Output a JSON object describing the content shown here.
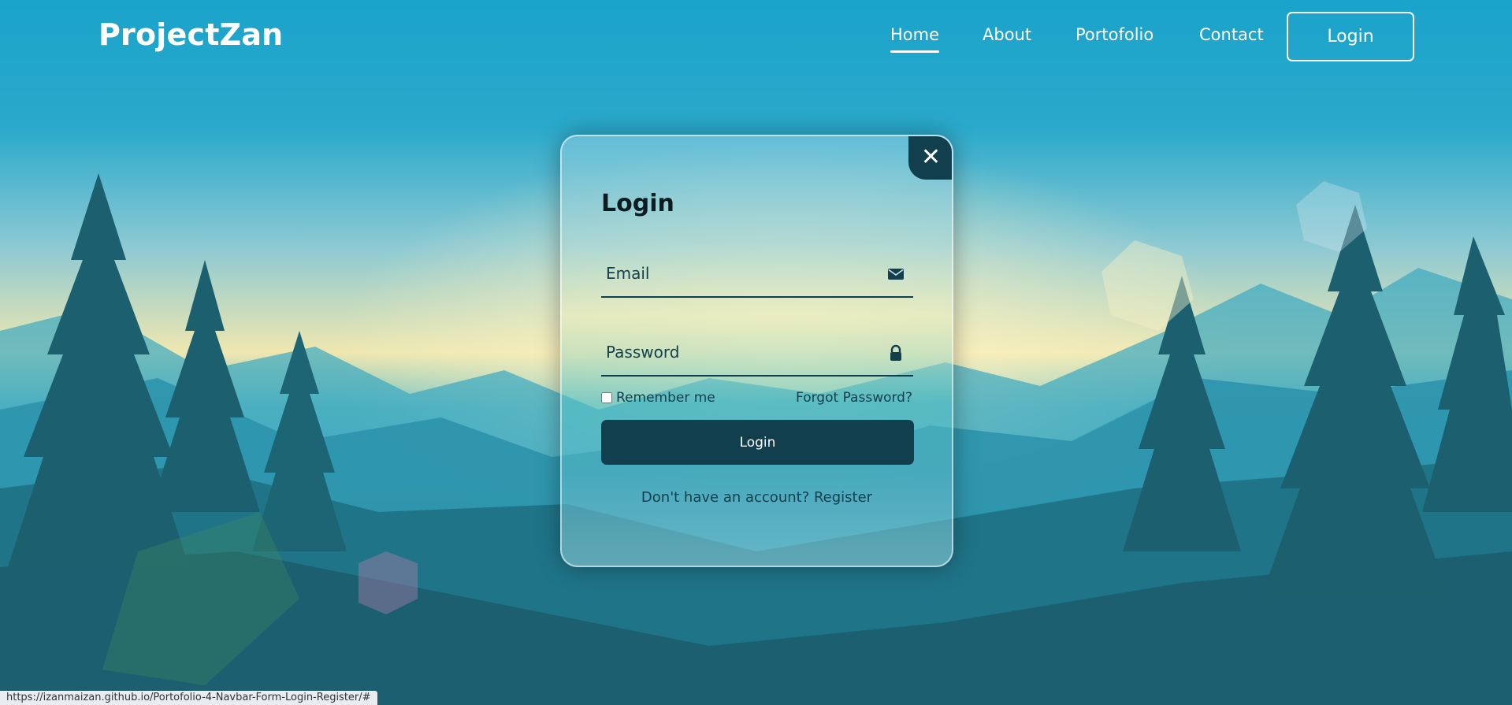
{
  "header": {
    "logo": "ProjectZan",
    "nav": [
      "Home",
      "About",
      "Portofolio",
      "Contact"
    ],
    "active_nav": "Home",
    "login_button": "Login"
  },
  "login_card": {
    "title": "Login",
    "email_placeholder": "Email",
    "password_placeholder": "Password",
    "remember_label": "Remember me",
    "forgot_label": "Forgot Password?",
    "submit_label": "Login",
    "register_prompt": "Don't have an account?",
    "register_link": "Register",
    "close_icon": "close-icon",
    "email_icon": "mail-icon",
    "password_icon": "lock-icon"
  },
  "status_url": "https://izanmaizan.github.io/Portofolio-4-Navbar-Form-Login-Register/#",
  "colors": {
    "primary_dark": "#123f4e",
    "text_light": "#ffffff",
    "sky_top": "#1ea6cc",
    "forest": "#1b5c6c"
  }
}
